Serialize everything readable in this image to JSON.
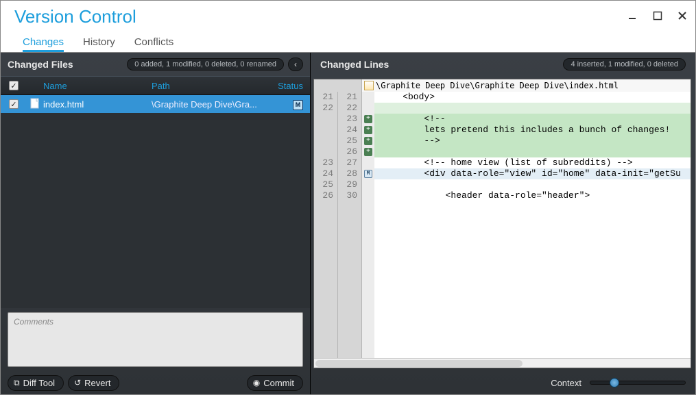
{
  "window": {
    "title": "Version Control"
  },
  "tabs": {
    "changes": "Changes",
    "history": "History",
    "conflicts": "Conflicts"
  },
  "left": {
    "header": "Changed Files",
    "summary": "0 added, 1 modified, 0 deleted, 0 renamed",
    "columns": {
      "name": "Name",
      "path": "Path",
      "status": "Status"
    },
    "file": {
      "name": "index.html",
      "path": "\\Graphite Deep Dive\\Gra...",
      "status": "M"
    },
    "comments_placeholder": "Comments",
    "buttons": {
      "diff": "Diff Tool",
      "revert": "Revert",
      "commit": "Commit"
    }
  },
  "right": {
    "header": "Changed Lines",
    "summary": "4 inserted, 1 modified, 0 deleted",
    "filepath": "\\Graphite Deep Dive\\Graphite Deep Dive\\index.html",
    "gutter_old": [
      "21",
      "22",
      "",
      "",
      "",
      "",
      "23",
      "24",
      "25",
      "26"
    ],
    "gutter_new": [
      "21",
      "22",
      "23",
      "24",
      "25",
      "26",
      "27",
      "28",
      "29",
      "30"
    ],
    "marks": [
      "",
      "",
      "plus",
      "plus",
      "plus",
      "plus",
      "",
      "mod",
      "",
      ""
    ],
    "lines": [
      {
        "t": "    <body>",
        "c": ""
      },
      {
        "t": "",
        "c": "ins-ctx"
      },
      {
        "t": "        <!--",
        "c": "inserted"
      },
      {
        "t": "        lets pretend this includes a bunch of changes!",
        "c": "inserted"
      },
      {
        "t": "        -->",
        "c": "inserted"
      },
      {
        "t": "",
        "c": "inserted"
      },
      {
        "t": "        <!-- home view (list of subreddits) -->",
        "c": ""
      },
      {
        "t": "        <div data-role=\"view\" id=\"home\" data-init=\"getSu",
        "c": "modified"
      },
      {
        "t": "",
        "c": ""
      },
      {
        "t": "            <header data-role=\"header\">",
        "c": ""
      }
    ],
    "context_label": "Context"
  }
}
